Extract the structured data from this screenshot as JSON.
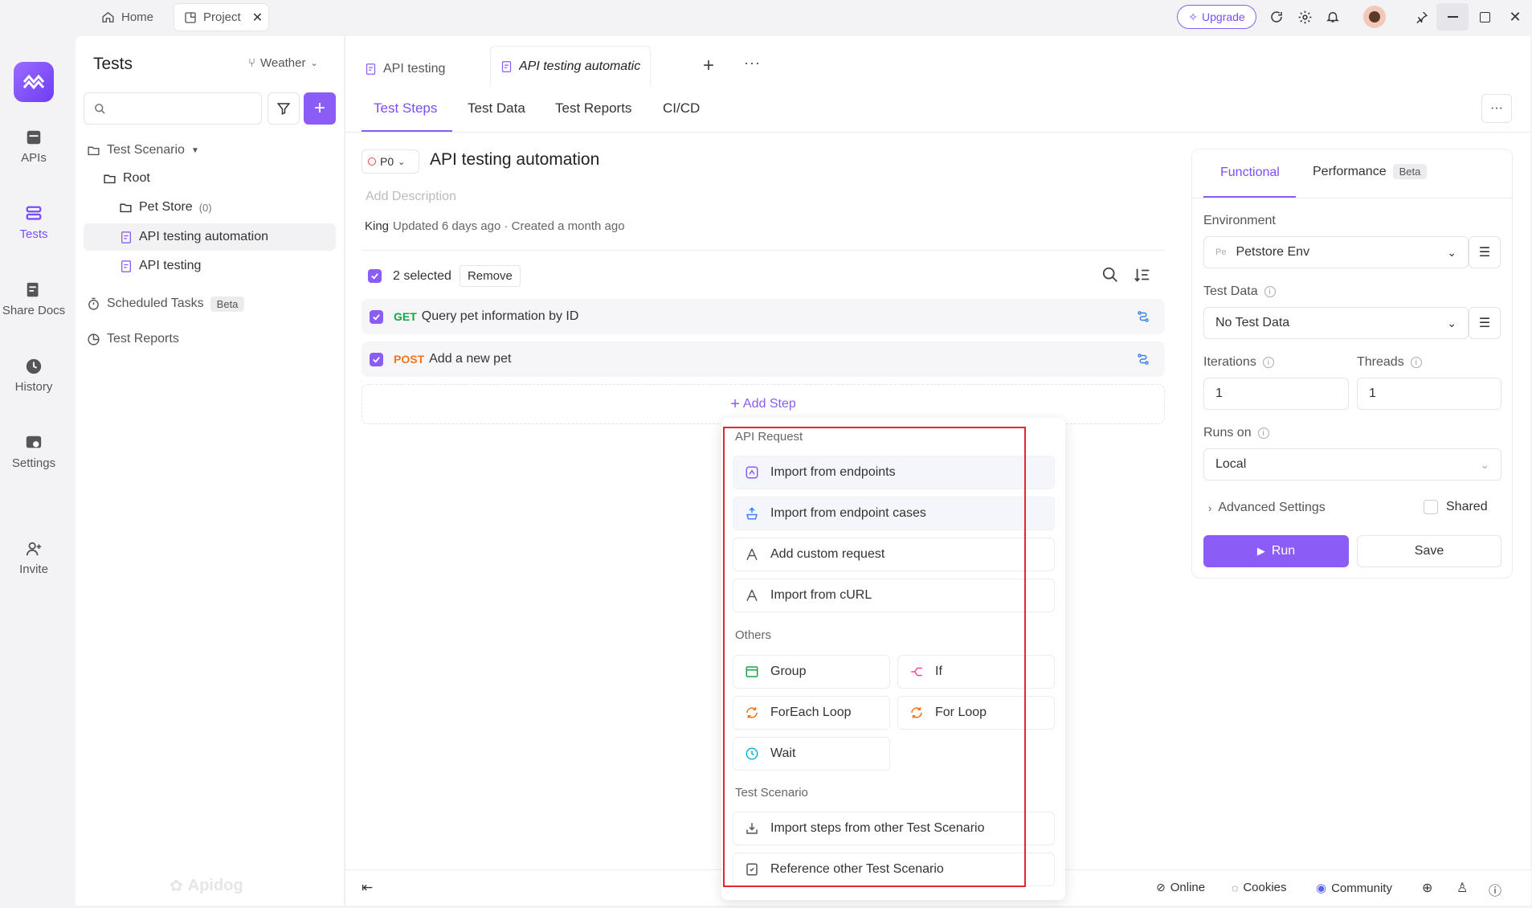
{
  "titlebar": {
    "home_tab": "Home",
    "project_tab": "Project",
    "upgrade": "Upgrade"
  },
  "rail": {
    "apis": "APIs",
    "tests": "Tests",
    "share_docs": "Share Docs",
    "history": "History",
    "settings": "Settings",
    "invite": "Invite"
  },
  "sidebar": {
    "title": "Tests",
    "branch": "Weather",
    "search_placeholder": "",
    "tree": {
      "test_scenario": "Test Scenario",
      "root": "Root",
      "pet_store": "Pet Store",
      "pet_store_count": "(0)",
      "api_testing_automation": "API testing automation",
      "api_testing": "API testing",
      "scheduled_tasks": "Scheduled Tasks",
      "scheduled_badge": "Beta",
      "test_reports": "Test Reports"
    },
    "watermark": "Apidog"
  },
  "main": {
    "file_tabs": [
      "API testing",
      "API testing automatic"
    ],
    "subtabs": [
      "Test Steps",
      "Test Data",
      "Test Reports",
      "CI/CD"
    ],
    "priority": "P0",
    "title": "API testing automation",
    "description_placeholder": "Add Description",
    "meta_user": "King",
    "meta_text": "Updated 6 days ago · Created a month ago",
    "selection": {
      "count_text": "2 selected",
      "remove": "Remove"
    },
    "steps": [
      {
        "method": "GET",
        "method_color": "#16a34a",
        "name": "Query pet information by ID"
      },
      {
        "method": "POST",
        "method_color": "#f97316",
        "name": "Add a new pet"
      }
    ],
    "add_step": "Add Step"
  },
  "dropdown": {
    "api_request_header": "API Request",
    "api_items": [
      "Import from endpoints",
      "Import from endpoint cases",
      "Add custom request",
      "Import from cURL"
    ],
    "others_header": "Others",
    "others_items": [
      "Group",
      "If",
      "ForEach Loop",
      "For Loop",
      "Wait"
    ],
    "scenario_header": "Test Scenario",
    "scenario_items": [
      "Import steps from other Test Scenario",
      "Reference other Test Scenario"
    ]
  },
  "run_panel": {
    "tab_functional": "Functional",
    "tab_performance": "Performance",
    "performance_badge": "Beta",
    "environment_label": "Environment",
    "environment_prefix": "Pe",
    "environment_value": "Petstore Env",
    "test_data_label": "Test Data",
    "test_data_value": "No Test Data",
    "iterations_label": "Iterations",
    "iterations_value": "1",
    "threads_label": "Threads",
    "threads_value": "1",
    "runs_on_label": "Runs on",
    "runs_on_value": "Local",
    "advanced": "Advanced Settings",
    "shared": "Shared",
    "run": "Run",
    "save": "Save",
    "accent": "#8b5cf6"
  },
  "bottom_bar": {
    "online": "Online",
    "cookies": "Cookies",
    "community": "Community"
  }
}
